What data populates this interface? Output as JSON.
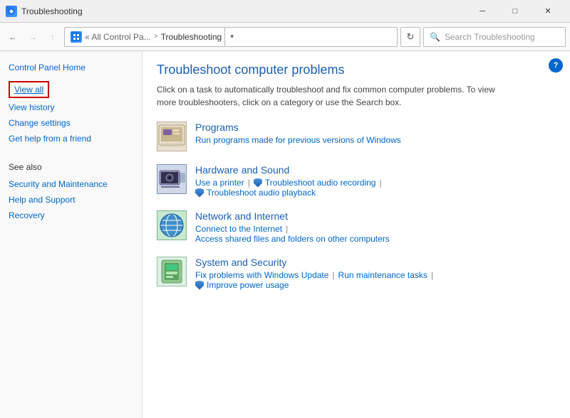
{
  "titleBar": {
    "icon": "⚙",
    "title": "Troubleshooting",
    "minimize": "─",
    "maximize": "□",
    "close": "✕"
  },
  "addressBar": {
    "back": "←",
    "forward": "→",
    "up": "↑",
    "addressIconText": "⊞",
    "pathGray": "« All Control Pa...",
    "pathSeparator": ">",
    "pathActive": "Troubleshooting",
    "dropdownArrow": "▾",
    "refresh": "↻",
    "searchPlaceholder": "Search Troubleshooting"
  },
  "sidebar": {
    "controlPanelHome": "Control Panel Home",
    "viewAll": "View all",
    "viewHistory": "View history",
    "changeSettings": "Change settings",
    "getHelp": "Get help from a friend",
    "seeAlso": "See also",
    "securityAndMaintenance": "Security and Maintenance",
    "helpAndSupport": "Help and Support",
    "recovery": "Recovery"
  },
  "content": {
    "helpBtn": "?",
    "title": "Troubleshoot computer problems",
    "description": "Click on a task to automatically troubleshoot and fix common computer problems. To view more troubleshooters, click on a category or use the Search box.",
    "categories": [
      {
        "name": "programs",
        "title": "Programs",
        "links": [
          {
            "text": "Run programs made for previous versions of Windows",
            "type": "plain"
          }
        ]
      },
      {
        "name": "hardware",
        "title": "Hardware and Sound",
        "links": [
          {
            "text": "Use a printer",
            "type": "plain"
          },
          {
            "text": "|",
            "type": "sep"
          },
          {
            "text": "Troubleshoot audio recording",
            "type": "shield"
          },
          {
            "text": "|",
            "type": "sep"
          },
          {
            "text": "Troubleshoot audio playback",
            "type": "shield"
          }
        ]
      },
      {
        "name": "network",
        "title": "Network and Internet",
        "links": [
          {
            "text": "Connect to the Internet",
            "type": "plain"
          },
          {
            "text": "|",
            "type": "sep"
          },
          {
            "text": "Access shared files and folders on other computers",
            "type": "plain"
          }
        ]
      },
      {
        "name": "system",
        "title": "System and Security",
        "links": [
          {
            "text": "Fix problems with Windows Update",
            "type": "plain"
          },
          {
            "text": "|",
            "type": "sep"
          },
          {
            "text": "Run maintenance tasks",
            "type": "plain"
          },
          {
            "text": "|",
            "type": "sep"
          },
          {
            "text": "Improve power usage",
            "type": "shield"
          }
        ]
      }
    ]
  }
}
